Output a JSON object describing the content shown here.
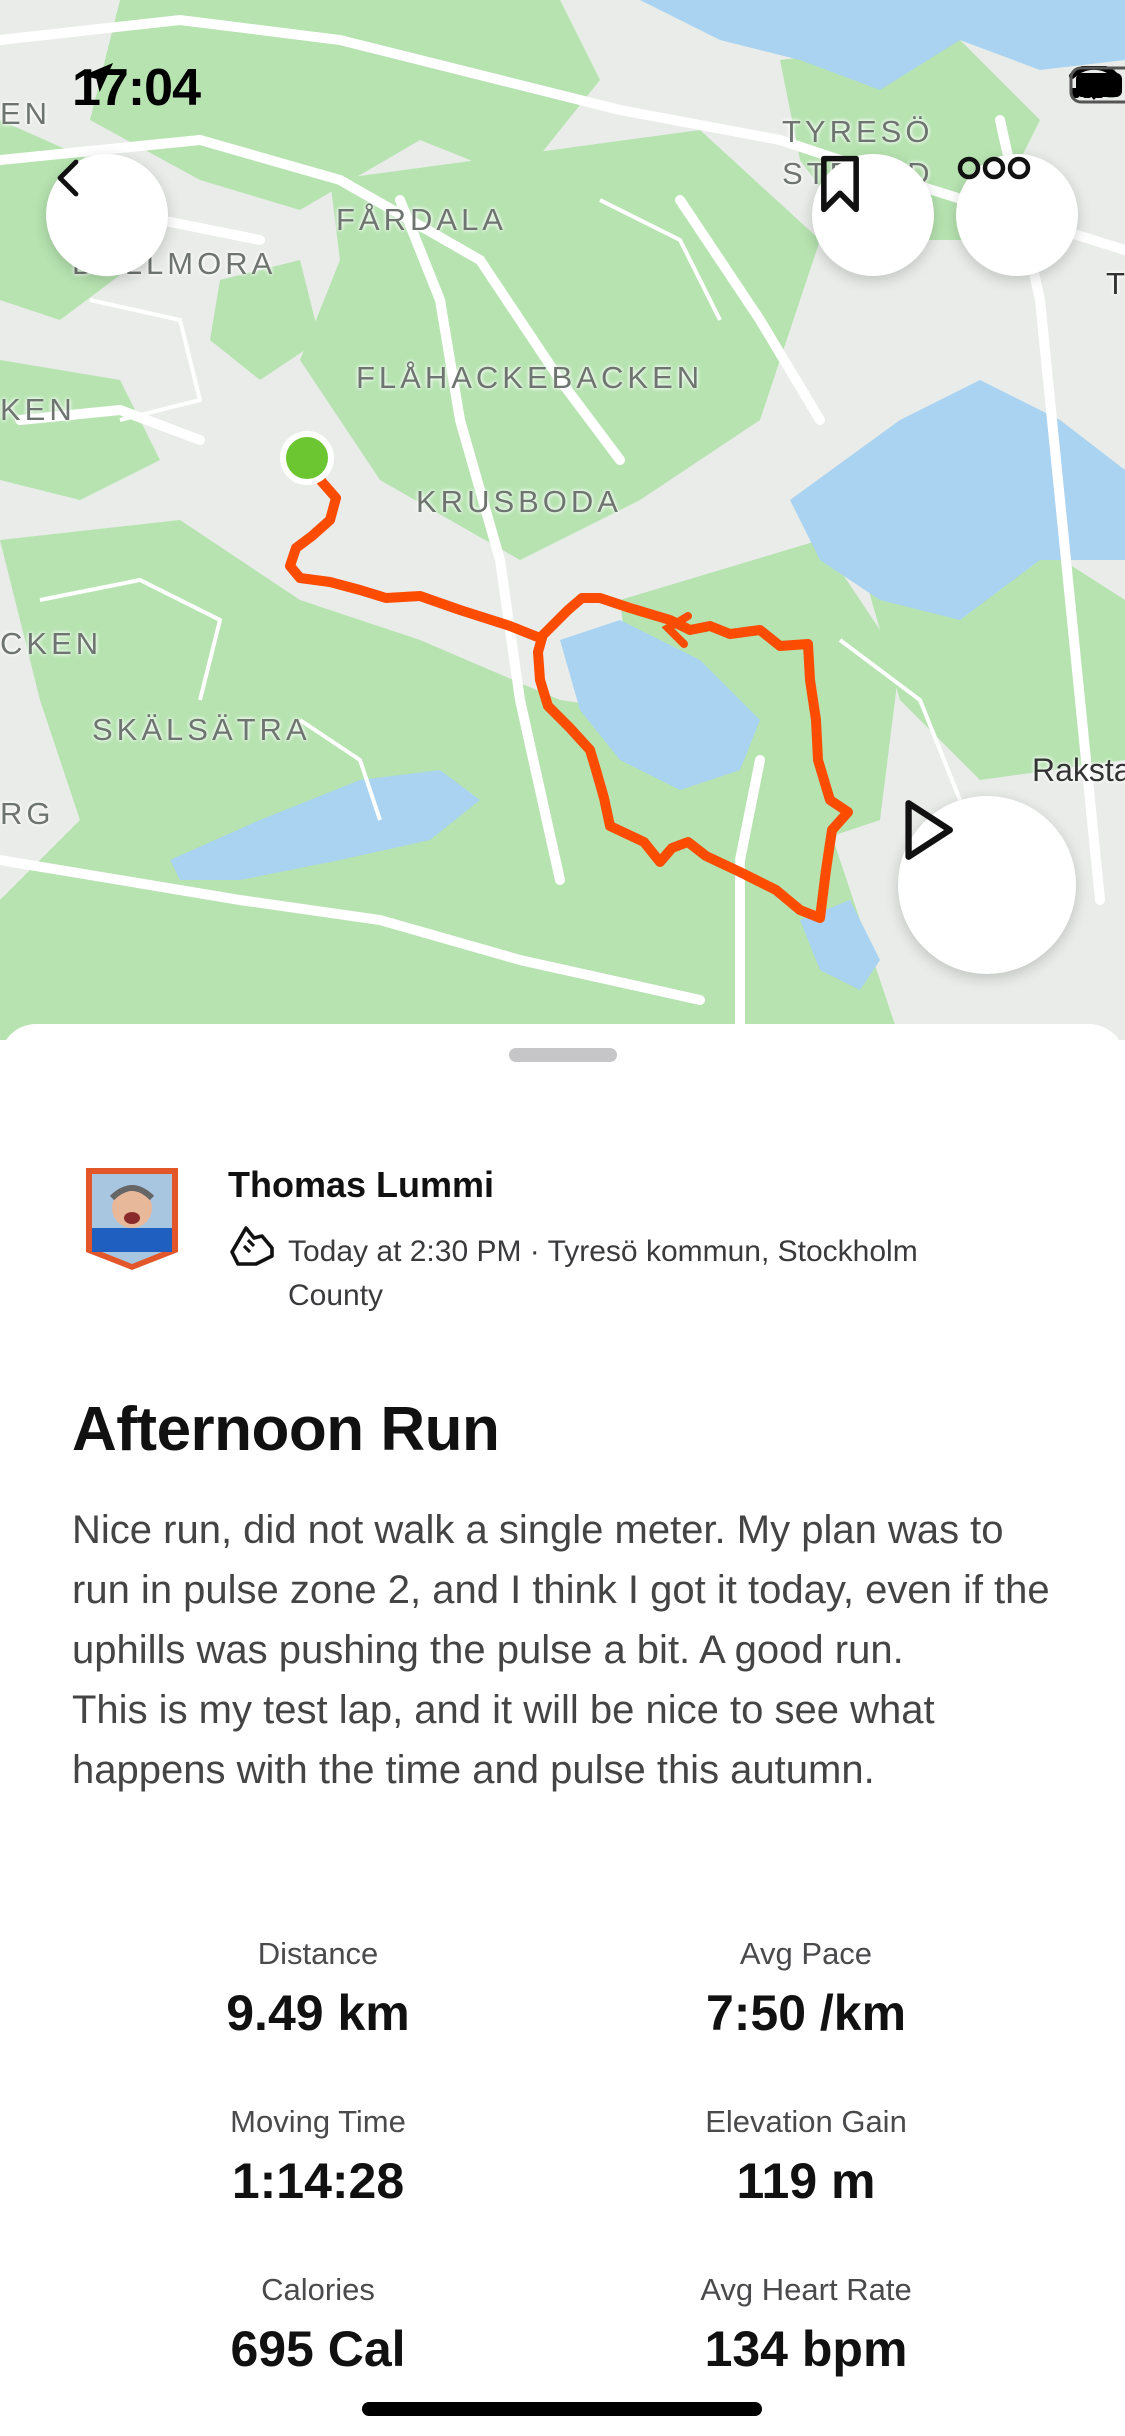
{
  "status_bar": {
    "time": "17:04"
  },
  "map": {
    "labels": {
      "tyreso_strand_1": "TYRESÖ",
      "tyreso_strand_2": "STRAND",
      "fardala": "FÅRDALA",
      "bollmora": "BOLLMORA",
      "flahackebacken": "FLÅHACKEBACKEN",
      "krusboda": "KRUSBODA",
      "skalsatra": "SKÄLSÄTRA",
      "raksta": "Raksta",
      "edge_en": "EN",
      "edge_ken": "KEN",
      "edge_cken": "CKEN",
      "edge_rg": "RG",
      "edge_t": "T"
    },
    "route_color": "#fc4c02",
    "start_marker_color": "#6cc631",
    "water_color": "#a9d3f1",
    "forest_color": "#b6e3b0"
  },
  "actions": {
    "back_icon": "chevron-left-icon",
    "bookmark_icon": "bookmark-icon",
    "more_icon": "more-dots-icon",
    "play_icon": "play-icon"
  },
  "activity": {
    "athlete_name": "Thomas Lummi",
    "sport_icon": "run-shoe-icon",
    "meta": "Today at 2:30 PM · Tyresö kommun, Stockholm County",
    "title": "Afternoon Run",
    "description": "Nice run, did not walk a single meter. My plan was to run in pulse zone 2, and I think I got it today, even if the uphills was pushing the pulse a bit. A good run.\nThis is my test lap, and it will be nice to see what happens with the time and pulse this autumn.",
    "stats": {
      "distance": {
        "label": "Distance",
        "value": "9.49 km"
      },
      "avg_pace": {
        "label": "Avg Pace",
        "value": "7:50 /km"
      },
      "moving_time": {
        "label": "Moving Time",
        "value": "1:14:28"
      },
      "elevation_gain": {
        "label": "Elevation Gain",
        "value": "119 m"
      },
      "calories": {
        "label": "Calories",
        "value": "695 Cal"
      },
      "avg_heart_rate": {
        "label": "Avg Heart Rate",
        "value": "134 bpm"
      }
    }
  }
}
